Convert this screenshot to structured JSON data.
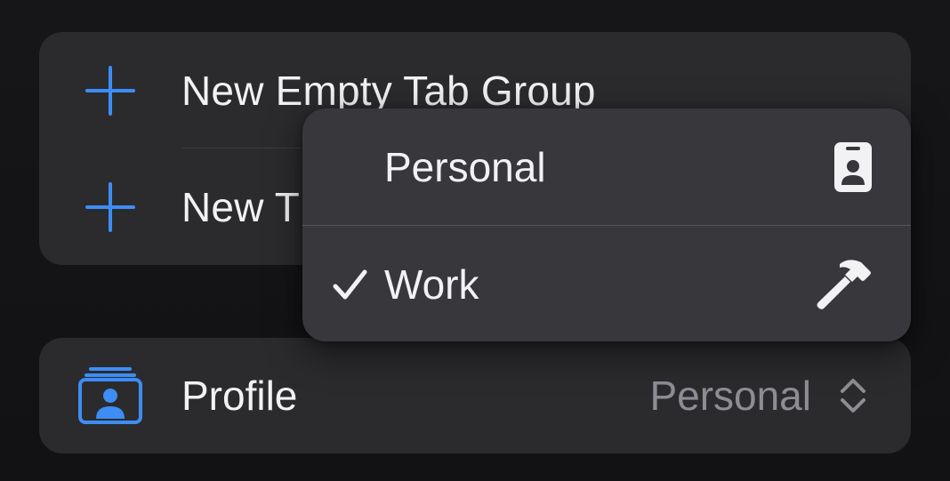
{
  "tab_group_menu": {
    "items": [
      {
        "label": "New Empty Tab Group",
        "icon": "plus-icon"
      },
      {
        "label": "New T",
        "icon": "plus-icon"
      }
    ]
  },
  "profile_row": {
    "label": "Profile",
    "icon": "profile-stack-icon",
    "value": "Personal",
    "control_icon": "chevron-up-down-icon"
  },
  "profile_dropdown": {
    "items": [
      {
        "label": "Personal",
        "icon": "id-badge-icon",
        "selected": false
      },
      {
        "label": "Work",
        "icon": "hammer-icon",
        "selected": true
      }
    ]
  },
  "colors": {
    "accent": "#3d8df5",
    "background": "#141416",
    "card": "#2b2b2e",
    "menu": "#38383c",
    "text_primary": "#f2f2f4",
    "text_secondary": "#8d8d93"
  }
}
